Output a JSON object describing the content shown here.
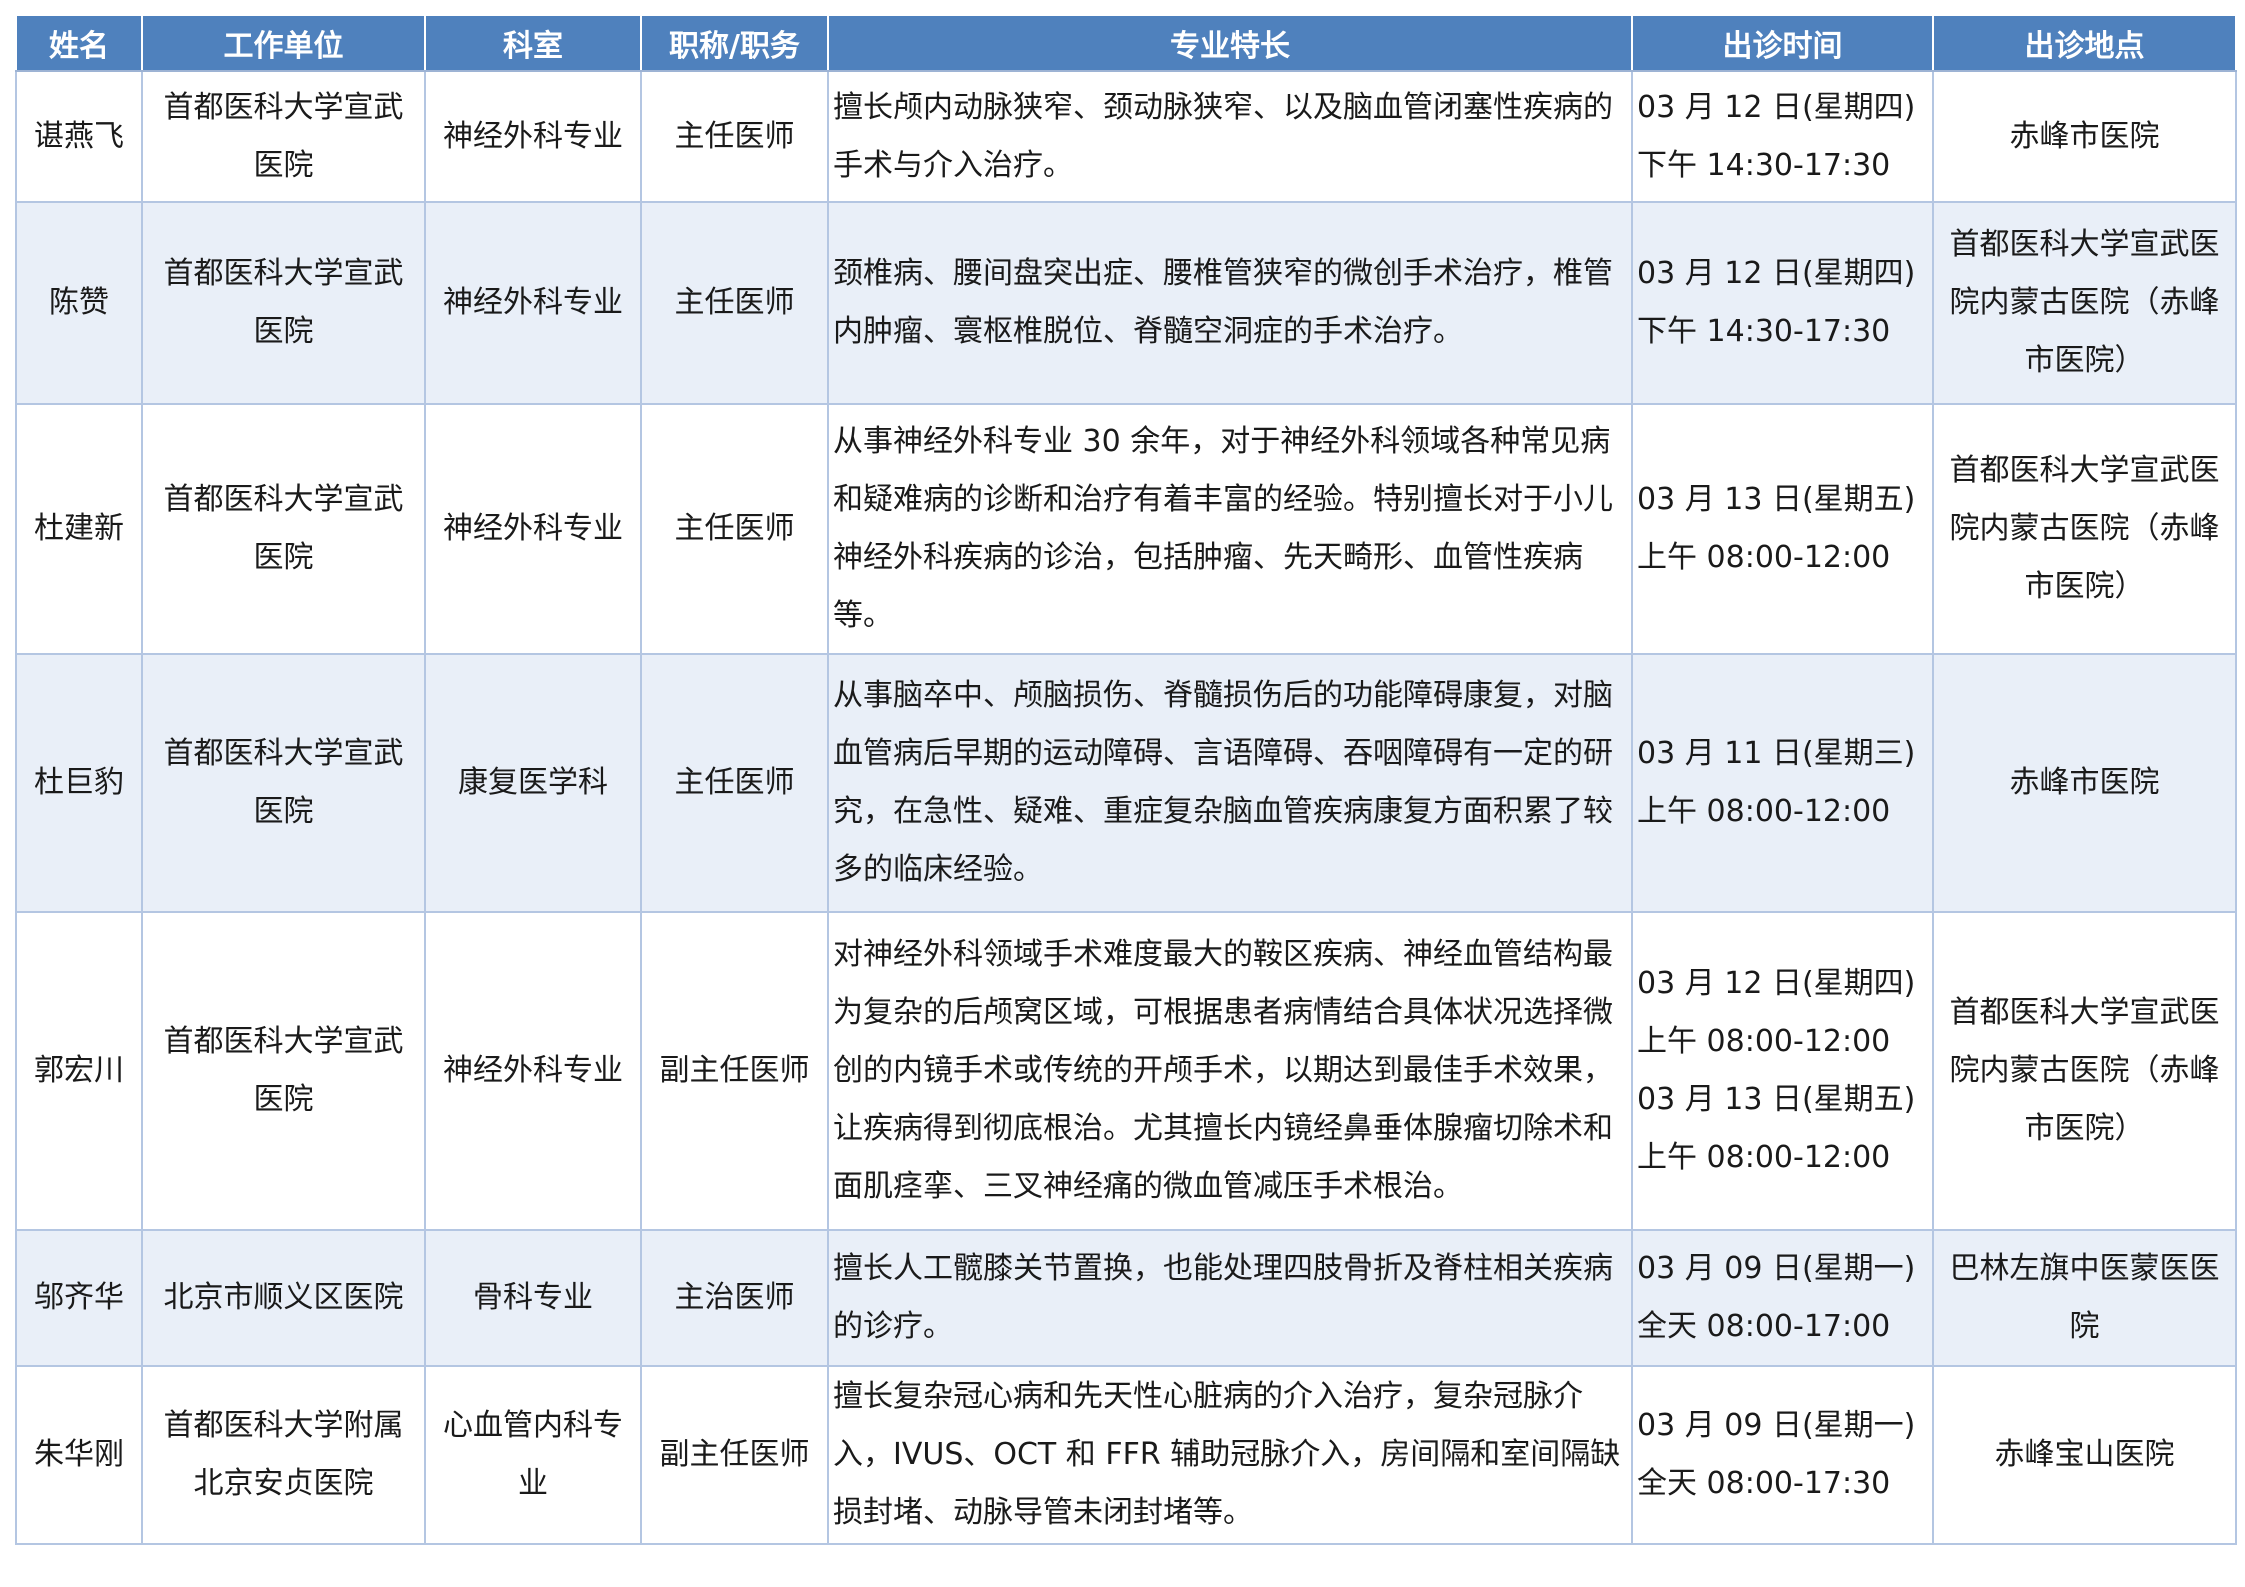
{
  "headers": [
    "姓名",
    "工作单位",
    "科室",
    "职称/职务",
    "专业特长",
    "出诊时间",
    "出诊地点"
  ],
  "rows": [
    {
      "name": "谌燕飞",
      "unit": "首都医科大学宣武\n医院",
      "dept": "神经外科专业",
      "title": "主任医师",
      "specialty": "擅长颅内动脉狭窄、颈动脉狭窄、以及脑血管闭塞性疾病的手术与介入治疗。",
      "time": "03 月 12 日(星期四)\n下午 14:30-17:30",
      "location": "赤峰市医院"
    },
    {
      "name": "陈赞",
      "unit": "首都医科大学宣武\n医院",
      "dept": "神经外科专业",
      "title": "主任医师",
      "specialty": "颈椎病、腰间盘突出症、腰椎管狭窄的微创手术治疗，椎管内肿瘤、寰枢椎脱位、脊髓空洞症的手术治疗。",
      "time": "03 月 12 日(星期四)\n下午 14:30-17:30",
      "location": "首都医科大学宣武医\n院内蒙古医院（赤峰\n市医院）"
    },
    {
      "name": "杜建新",
      "unit": "首都医科大学宣武\n医院",
      "dept": "神经外科专业",
      "title": "主任医师",
      "specialty": "从事神经外科专业 30 余年，对于神经外科领域各种常见病和疑难病的诊断和治疗有着丰富的经验。特别擅长对于小儿神经外科疾病的诊治，包括肿瘤、先天畸形、血管性疾病等。",
      "time": "03 月 13 日(星期五)\n上午 08:00-12:00",
      "location": "首都医科大学宣武医\n院内蒙古医院（赤峰\n市医院）"
    },
    {
      "name": "杜巨豹",
      "unit": "首都医科大学宣武\n医院",
      "dept": "康复医学科",
      "title": "主任医师",
      "specialty": "从事脑卒中、颅脑损伤、脊髓损伤后的功能障碍康复，对脑血管病后早期的运动障碍、言语障碍、吞咽障碍有一定的研究，在急性、疑难、重症复杂脑血管疾病康复方面积累了较多的临床经验。",
      "time": "03 月 11 日(星期三)\n上午 08:00-12:00",
      "location": "赤峰市医院"
    },
    {
      "name": "郭宏川",
      "unit": "首都医科大学宣武\n医院",
      "dept": "神经外科专业",
      "title": "副主任医师",
      "specialty": "对神经外科领域手术难度最大的鞍区疾病、神经血管结构最为复杂的后颅窝区域，可根据患者病情结合具体状况选择微创的内镜手术或传统的开颅手术，以期达到最佳手术效果，让疾病得到彻底根治。尤其擅长内镜经鼻垂体腺瘤切除术和面肌痉挛、三叉神经痛的微血管减压手术根治。",
      "time": "03 月 12 日(星期四)\n上午 08:00-12:00\n03 月 13 日(星期五)\n上午 08:00-12:00",
      "location": "首都医科大学宣武医\n院内蒙古医院（赤峰\n市医院）"
    },
    {
      "name": "邬齐华",
      "unit": "北京市顺义区医院",
      "dept": "骨科专业",
      "title": "主治医师",
      "specialty": "擅长人工髋膝关节置换，也能处理四肢骨折及脊柱相关疾病的诊疗。",
      "time": "03 月 09 日(星期一)\n全天 08:00-17:00",
      "location": "巴林左旗中医蒙医医\n院"
    },
    {
      "name": "朱华刚",
      "unit": "首都医科大学附属\n北京安贞医院",
      "dept": "心血管内科专\n业",
      "title": "副主任医师",
      "specialty": "擅长复杂冠心病和先天性心脏病的介入治疗，复杂冠脉介入，IVUS、OCT 和 FFR 辅助冠脉介入，房间隔和室间隔缺损封堵、动脉导管未闭封堵等。",
      "time": "03 月 09 日(星期一)\n全天 08:00-17:30",
      "location": "赤峰宝山医院"
    }
  ]
}
